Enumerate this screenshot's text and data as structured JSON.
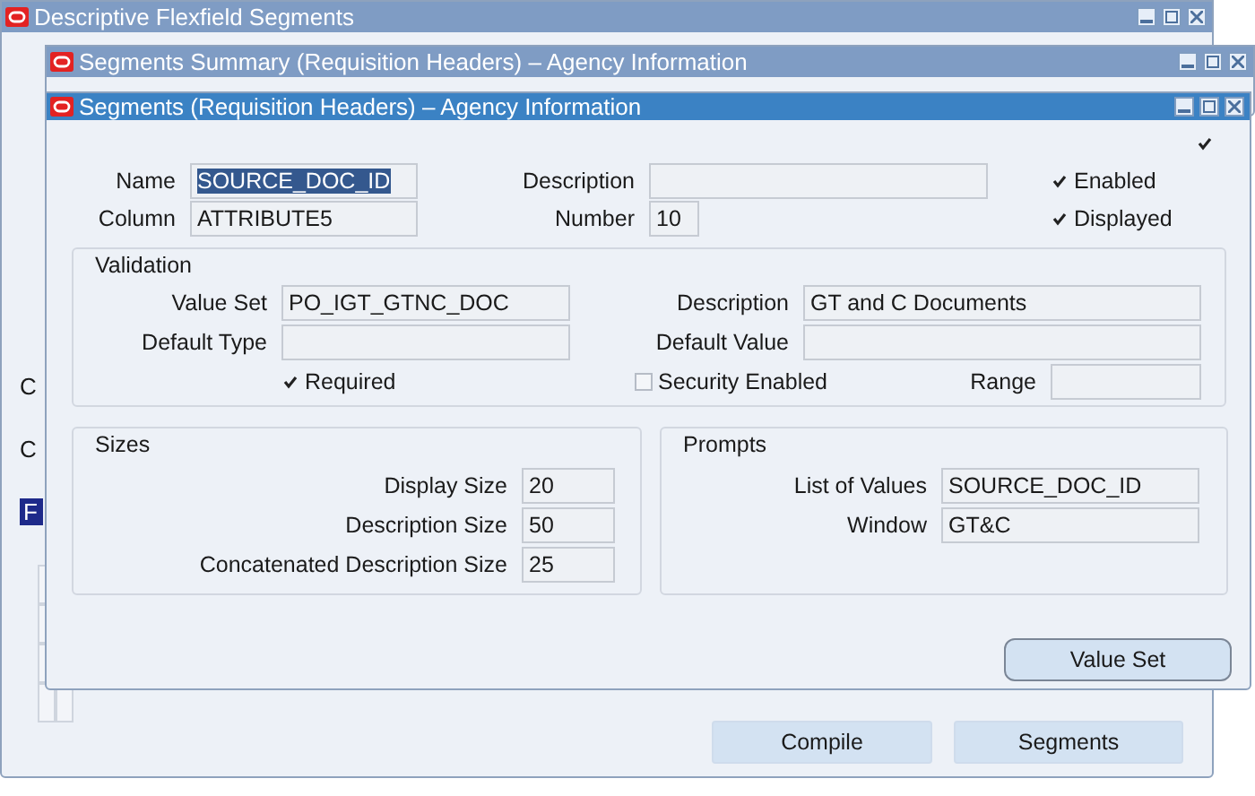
{
  "back_window": {
    "title": "Descriptive Flexfield Segments",
    "active": false,
    "edge_texts": [
      "C",
      "C",
      "F"
    ],
    "buttons": [
      {
        "label": "Compile"
      },
      {
        "label": "Segments"
      }
    ]
  },
  "middle_window": {
    "title": "Segments Summary (Requisition Headers) – Agency Information",
    "active": false
  },
  "front_window": {
    "title": "Segments (Requisition Headers) – Agency Information",
    "active": true,
    "corner_checkbox": {
      "checked": true
    },
    "name": {
      "label": "Name",
      "value": "SOURCE_DOC_ID",
      "text_selected": true
    },
    "column": {
      "label": "Column",
      "value": "ATTRIBUTE5"
    },
    "description": {
      "label": "Description"
    },
    "number": {
      "label": "Number",
      "value": "10"
    },
    "enabled": {
      "label": "Enabled",
      "checked": true
    },
    "displayed": {
      "label": "Displayed",
      "checked": true
    },
    "validation": {
      "title": "Validation",
      "value_set": {
        "label": "Value Set",
        "value": "PO_IGT_GTNC_DOC"
      },
      "description": {
        "label": "Description",
        "value": "GT and C Documents"
      },
      "default_type": {
        "label": "Default Type"
      },
      "default_value": {
        "label": "Default Value"
      },
      "required": {
        "label": "Required",
        "checked": true
      },
      "security_enabled": {
        "label": "Security Enabled",
        "checked": false
      },
      "range": {
        "label": "Range"
      }
    },
    "sizes": {
      "title": "Sizes",
      "rows": [
        {
          "label": "Display Size",
          "value": "20"
        },
        {
          "label": "Description Size",
          "value": "50"
        },
        {
          "label": "Concatenated Description Size",
          "value": "25"
        }
      ]
    },
    "prompts": {
      "title": "Prompts",
      "rows": [
        {
          "label": "List of Values",
          "value": "SOURCE_DOC_ID"
        },
        {
          "label": "Window",
          "value": "GT&C"
        }
      ]
    },
    "value_set_button": {
      "label": "Value Set"
    }
  }
}
